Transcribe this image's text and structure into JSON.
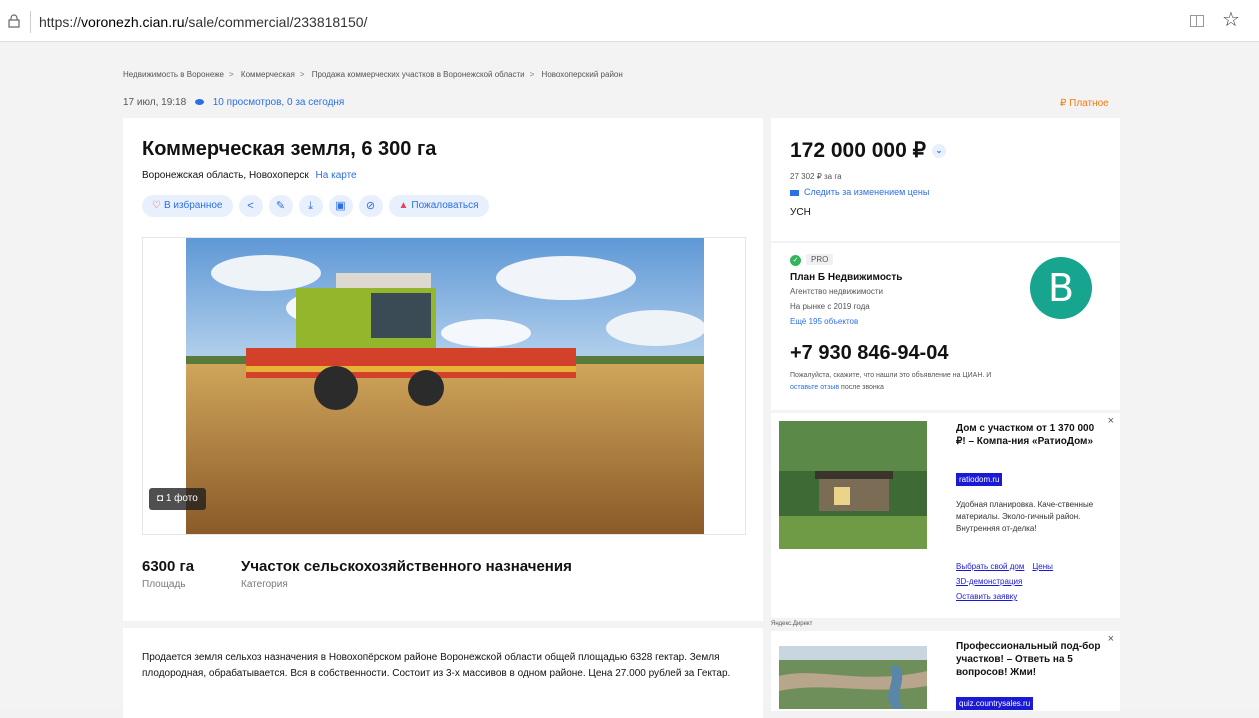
{
  "browser": {
    "url_prefix": "https://",
    "url_host": "voronezh.cian.ru",
    "url_path": "/sale/commercial/233818150/"
  },
  "breadcrumb": [
    "Недвижимость в Воронеже",
    "Коммерческая",
    "Продажа коммерческих участков в Воронежской области",
    "Новохоперский район"
  ],
  "meta": {
    "date": "17 июл, 19:18",
    "views": "10 просмотров, 0 за сегодня",
    "paid_label": "₽ Платное"
  },
  "listing": {
    "title": "Коммерческая земля, 6 300 га",
    "address": "Воронежская область, Новохоперск",
    "map_link": "На карте",
    "favorite_label": "В избранное",
    "complain_label": "Пожаловаться",
    "photo_badge": "1 фото",
    "area_value": "6300 га",
    "area_label": "Площадь",
    "category_value": "Участок сельскохозяйственного назначения",
    "category_label": "Категория",
    "description": "Продается земля сельхоз назначения в Новохопёрском районе Воронежской области общей площадью 6328 гектар. Земля плодородная, обрабатывается. Вся в собственности. Состоит из 3-х массивов в одном районе. Цена 27.000 рублей за Гектар."
  },
  "price": {
    "total": "172 000 000 ₽",
    "per_ha": "27 302 ₽ за га",
    "follow_label": "Следить за изменением цены",
    "tax": "УСН"
  },
  "agent": {
    "badge": "PRO",
    "name": "План Б Недвижимость",
    "type": "Агентство недвижимости",
    "since": "На рынке с 2019 года",
    "more": "Ещё 195 объектов",
    "phone": "+7 930 846-94-04",
    "note_a": "Пожалуйста, скажите, что нашли это объявление на ЦИАН. И ",
    "note_link": "оставьте отзыв",
    "note_b": " после звонка"
  },
  "ads": [
    {
      "title": "Дом с участком от 1 370 000 ₽! – Компа-ния «РатиоДом»",
      "domain": "ratiodom.ru",
      "body": "Удобная планировка. Каче-ственные материалы. Эколо-гичный район. Внутренняя от-делка!",
      "links": [
        "Выбрать свой дом",
        "Цены",
        "3D-демонстрация",
        "Оставить заявку"
      ]
    },
    {
      "title": "Профессиональный под-бор участков! – Ответь на 5 вопросов! Жми!",
      "domain": "quiz.countrysales.ru"
    }
  ],
  "yandex_direct": "Яндекс.Директ",
  "colors": {
    "accent": "#2b6fe6",
    "paid": "#f27b12",
    "logo": "#17a58f",
    "pro_check": "#32b45a"
  }
}
